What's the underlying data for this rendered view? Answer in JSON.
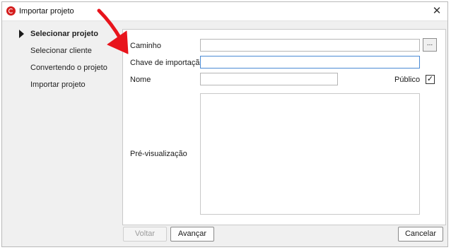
{
  "window": {
    "title": "Importar projeto",
    "close_glyph": "✕",
    "icon": "app-logo-icon",
    "accent_color": "#d51f1f"
  },
  "steps": [
    {
      "label": "Selecionar projeto",
      "active": true
    },
    {
      "label": "Selecionar cliente",
      "active": false
    },
    {
      "label": "Convertendo o projeto",
      "active": false
    },
    {
      "label": "Importar projeto",
      "active": false
    }
  ],
  "form": {
    "caminho_label": "Caminho",
    "caminho_value": "",
    "browse_label": "...",
    "chave_label": "Chave de importação",
    "chave_value": "",
    "nome_label": "Nome",
    "nome_value": "",
    "publico_label": "Público",
    "publico_checked": true,
    "publico_glyph": "✓",
    "preview_label": "Pré-visualização"
  },
  "buttons": {
    "voltar": "Voltar",
    "avancar": "Avançar",
    "cancelar": "Cancelar"
  },
  "annotation": {
    "color": "#e8141c"
  }
}
